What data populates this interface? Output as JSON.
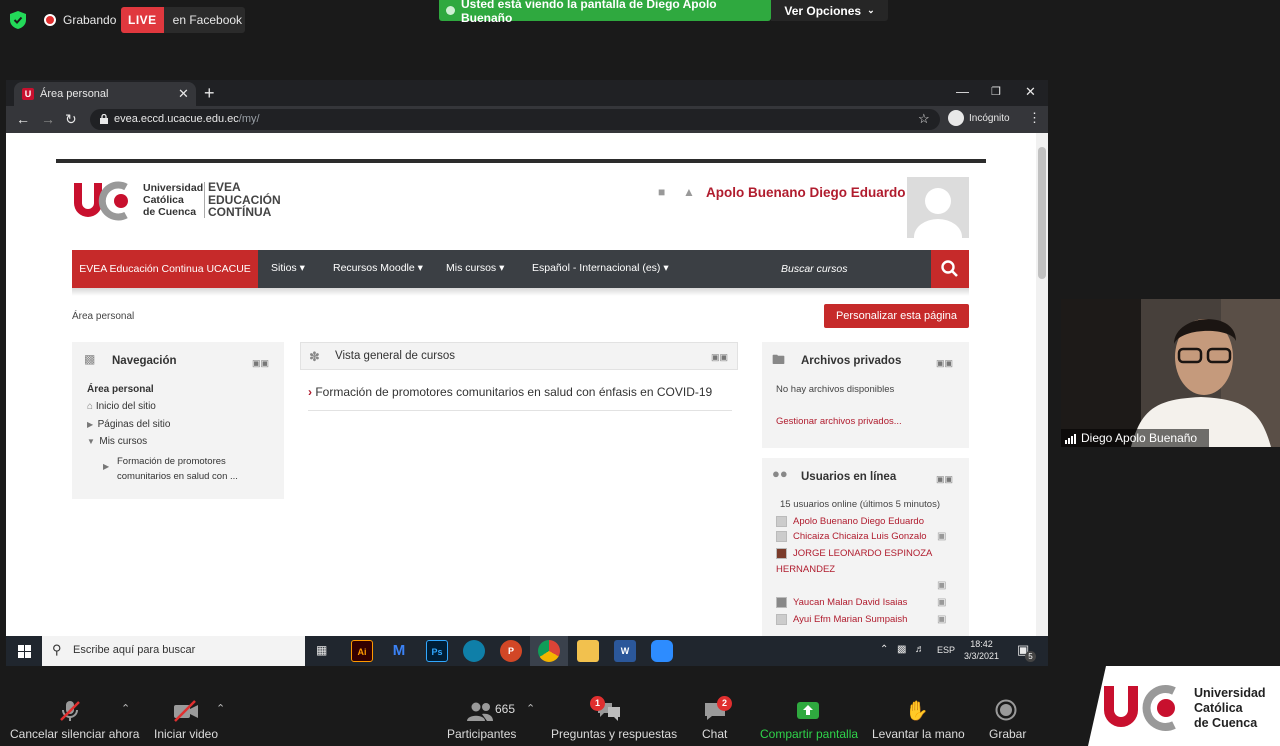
{
  "zoom_top": {
    "recording": "Grabando",
    "live_badge": "LIVE",
    "live_target": "en Facebook",
    "share_banner": "Usted está viendo la pantalla de Diego Apolo Buenaño",
    "view_options": "Ver Opciones"
  },
  "browser": {
    "tab_title": "Área personal",
    "url_host": "evea.eccd.ucacue.edu.ec",
    "url_path": "/my/",
    "incognito": "Incógnito"
  },
  "site": {
    "logo_line1": "Universidad",
    "logo_line2": "Católica",
    "logo_line3": "de Cuenca",
    "logo_r1": "EVEA",
    "logo_r2": "EDUCACIÓN",
    "logo_r3": "CONTÍNUA",
    "user_name": "Apolo Buenano Diego Eduardo",
    "nav": {
      "brand": "EVEA Educación Continua UCACUE",
      "items": [
        "Sitios",
        "Recursos Moodle",
        "Mis cursos",
        "Español - Internacional (es)"
      ],
      "search_placeholder": "Buscar cursos"
    },
    "breadcrumb": "Área personal",
    "customize_button": "Personalizar esta página",
    "navigation_block": {
      "title": "Navegación",
      "items": [
        "Área personal",
        "Inicio del sitio",
        "Páginas del sitio",
        "Mis cursos"
      ],
      "course_l1": "Formación de promotores",
      "course_l2": "comunitarios en salud con ..."
    },
    "courses_block": {
      "title": "Vista general de cursos",
      "course": "Formación de promotores comunitarios en salud con énfasis en COVID-19"
    },
    "private_files": {
      "title": "Archivos privados",
      "empty": "No hay archivos disponibles",
      "manage": "Gestionar archivos privados..."
    },
    "online_users": {
      "title": "Usuarios en línea",
      "summary": "15 usuarios online (últimos 5 minutos)",
      "users": [
        "Apolo Buenano Diego Eduardo",
        "Chicaiza Chicaiza Luis Gonzalo",
        "JORGE LEONARDO ESPINOZA",
        "HERNANDEZ",
        "Yaucan Malan David Isaias",
        "Ayui Efm Marian Sumpaish"
      ]
    }
  },
  "taskbar": {
    "search": "Escribe aquí para buscar",
    "lang": "ESP",
    "time": "18:42",
    "date": "3/3/2021",
    "notif_count": "5"
  },
  "video": {
    "participant": "Diego Apolo Buenaño"
  },
  "zoom_bottom": {
    "mute": "Cancelar silenciar ahora",
    "video": "Iniciar video",
    "participants": "Participantes",
    "participants_count": "665",
    "qa": "Preguntas y respuestas",
    "qa_badge": "1",
    "chat": "Chat",
    "chat_badge": "2",
    "share": "Compartir pantalla",
    "raise_hand": "Levantar la mano",
    "record": "Grabar",
    "brand_l1": "Universidad",
    "brand_l2": "Católica",
    "brand_l3": "de Cuenca"
  },
  "colors": {
    "brand_red": "#c62a2a",
    "zoom_green": "#2fa93f",
    "live_red": "#e0383e",
    "navbar_dark": "#3b3f44"
  }
}
